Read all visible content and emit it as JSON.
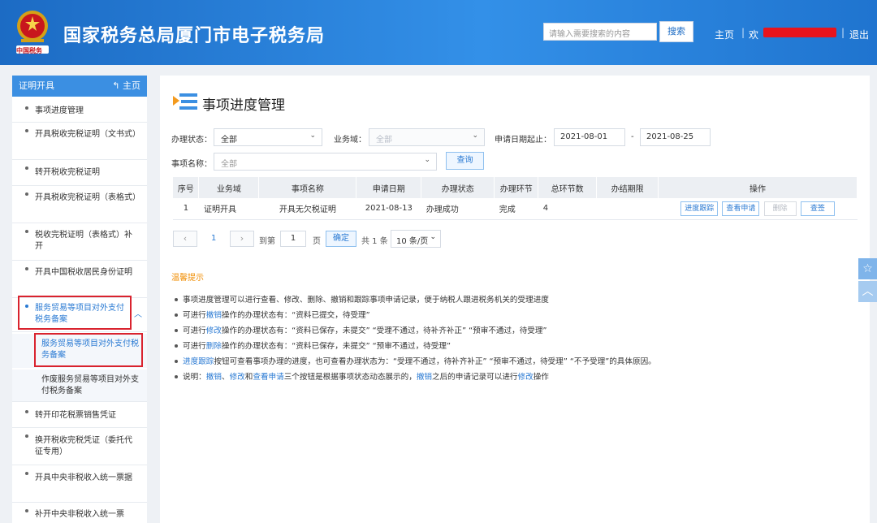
{
  "header": {
    "site_title": "国家税务总局厦门市电子税务局",
    "search_placeholder": "请输入需要搜索的内容",
    "search_button": "搜索",
    "nav_home": "主页",
    "nav_user": "欢",
    "nav_logout": "退出",
    "separator": "|",
    "emblem_text": "中国税务"
  },
  "sidebar": {
    "title": "证明开具",
    "home_label": "主页",
    "items": [
      "事项进度管理",
      "开具税收完税证明（文书式）",
      "转开税收完税证明",
      "开具税收完税证明（表格式）",
      "税收完税证明（表格式）补开",
      "开具中国税收居民身份证明",
      "服务贸易等项目对外支付税务备案",
      "转开印花税票销售凭证",
      "换开税收完税凭证（委托代征专用）",
      "开具中央非税收入统一票据",
      "补开中央非税收入统一票"
    ],
    "sub_items": [
      "服务贸易等项目对外支付税务备案",
      "作废服务贸易等项目对外支付税务备案"
    ]
  },
  "main": {
    "title": "事项进度管理",
    "filters": {
      "status_label": "办理状态：",
      "status_value": "全部",
      "domain_label": "业务域：",
      "domain_value": "全部",
      "date_label": "申请日期起止：",
      "date_start": "2021-08-01",
      "date_sep": "-",
      "date_end": "2021-08-25",
      "item_label": "事项名称：",
      "item_value": "全部",
      "query_button": "查询"
    },
    "table": {
      "headers": [
        "序号",
        "业务域",
        "事项名称",
        "申请日期",
        "办理状态",
        "办理环节",
        "总环节数",
        "办结期限",
        "操作"
      ],
      "rows": [
        {
          "no": "1",
          "domain": "证明开具",
          "name": "开具无欠税证明",
          "date": "2021-08-13",
          "status": "办理成功",
          "stage": "完成",
          "total": "4",
          "deadline": "",
          "actions": [
            "进度跟踪",
            "查看申请",
            "删除",
            "查签"
          ]
        }
      ]
    },
    "pager": {
      "prev": "‹",
      "page": "1",
      "next": "›",
      "goto_label": "到第",
      "goto_value": "1",
      "page_unit": "页",
      "ok": "确定",
      "total": "共 1 条",
      "size": "10 条/页"
    },
    "tips": {
      "title": "温馨提示",
      "lines": [
        [
          "事项进度管理可以进行查看、修改、删除、撤销和跟踪事项申请记录，便于纳税人跟进税务机关的受理进度"
        ],
        [
          "可进行",
          "撤销",
          "操作的办理状态有：“资料已提交，待受理”"
        ],
        [
          "可进行",
          "修改",
          "操作的办理状态有：“资料已保存，未提交”  “受理不通过，待补齐补正”  “预审不通过，待受理”"
        ],
        [
          "可进行",
          "删除",
          "操作的办理状态有：“资料已保存，未提交”  “预审不通过，待受理”"
        ],
        [
          "",
          "进度跟踪",
          "按钮可查看事项办理的进度，也可查看办理状态为：“受理不通过，待补齐补正”  “预审不通过，待受理”  “不予受理”的具体原因。"
        ],
        [
          "说明：",
          "撤销",
          "、",
          "修改",
          "和",
          "查看申请",
          "三个按钮是根据事项状态动态展示的，",
          "撤销",
          "之后的申请记录可以进行",
          "修改",
          "操作"
        ]
      ]
    }
  },
  "float_tools": [
    "☆",
    "︿"
  ],
  "colors": {
    "header_blue": "#2a82dc",
    "link_blue": "#2a7ad3",
    "tip_orange": "#f08c00",
    "highlight_red": "#d9232e"
  }
}
